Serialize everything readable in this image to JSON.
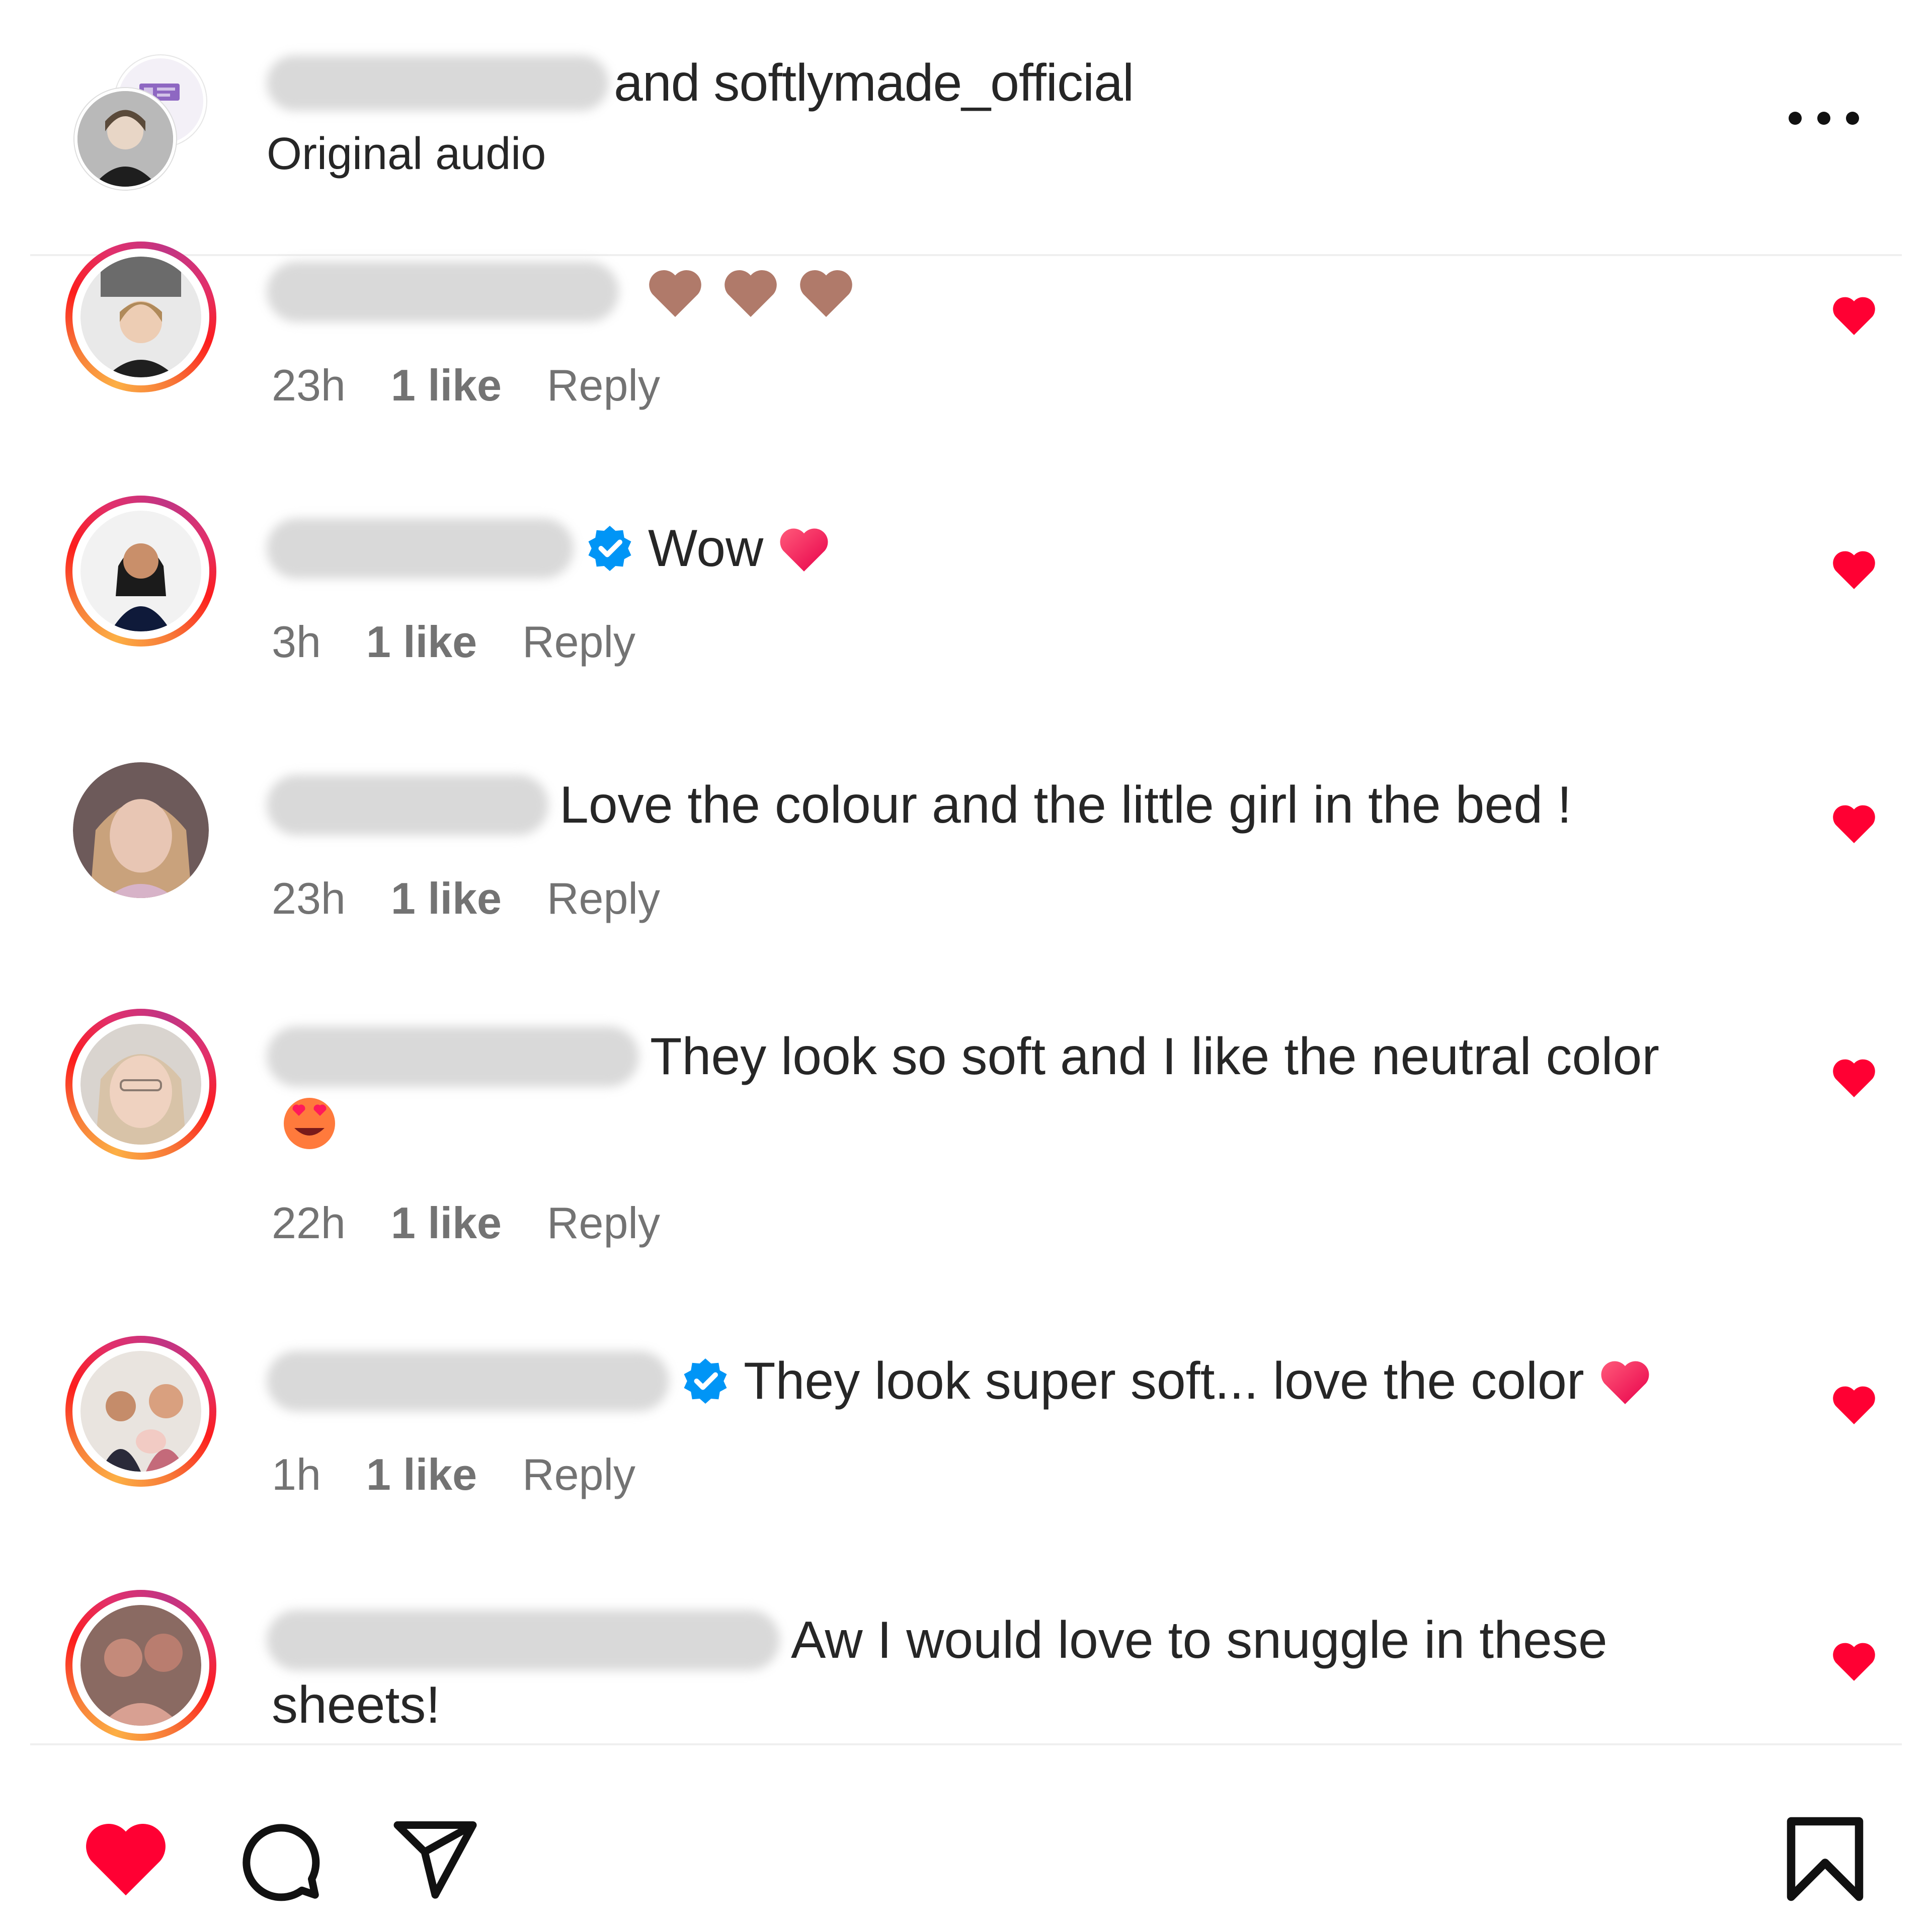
{
  "header": {
    "title_suffix": "and softlymade_official",
    "subtitle": "Original audio",
    "more_icon": "more-horizontal-icon"
  },
  "comments": [
    {
      "time": "23h",
      "likes": "1 like",
      "reply": "Reply",
      "text": "",
      "emoji": [
        "brown-heart",
        "brown-heart",
        "brown-heart"
      ],
      "liked": true
    },
    {
      "time": "3h",
      "likes": "1 like",
      "reply": "Reply",
      "text": "Wow",
      "verified": true,
      "emoji": [
        "red-heart"
      ],
      "liked": true
    },
    {
      "time": "23h",
      "likes": "1 like",
      "reply": "Reply",
      "text": "Love the colour and the little girl in the bed !",
      "liked": true
    },
    {
      "time": "22h",
      "likes": "1 like",
      "reply": "Reply",
      "text": "They look so soft and I like the neutral color",
      "emoji": [
        "heart-eyes"
      ],
      "liked": true
    },
    {
      "time": "1h",
      "likes": "1 like",
      "reply": "Reply",
      "text": "They look super soft... love the color",
      "verified": true,
      "emoji": [
        "red-heart"
      ],
      "liked": true
    },
    {
      "text": "Aw I would love to snuggle in these",
      "text_cont": "sheets!",
      "liked": true
    }
  ],
  "bottom_bar": {
    "icons": [
      "heart-filled-icon",
      "comment-icon",
      "share-icon",
      "bookmark-icon"
    ]
  },
  "colors": {
    "like_red": "#ff0033",
    "text": "#262626",
    "meta": "#737373",
    "verified_blue": "#0095f6"
  }
}
